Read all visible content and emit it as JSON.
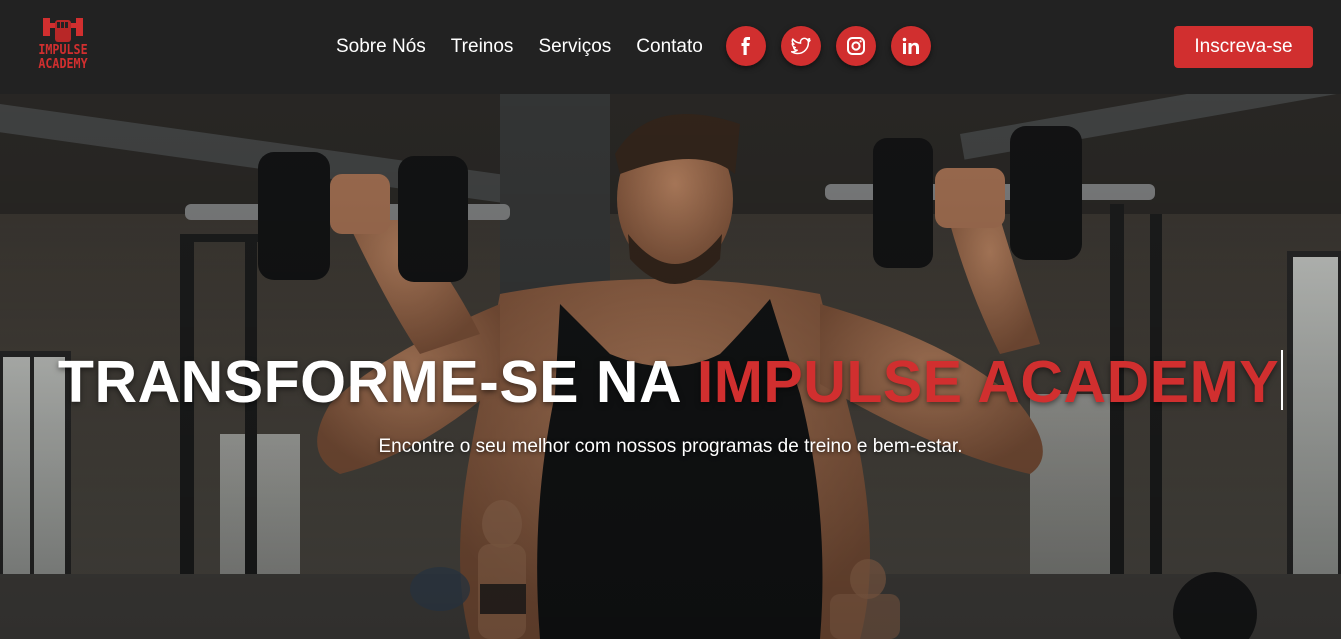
{
  "brand": {
    "logo_line1": "IMPULSE",
    "logo_line2": "ACADEMY",
    "logo_icon": "dumbbell-fist-icon",
    "accent_color": "#d12f2f"
  },
  "nav": {
    "links": [
      "Sobre Nós",
      "Treinos",
      "Serviços",
      "Contato"
    ],
    "socials": [
      "facebook-icon",
      "twitter-icon",
      "instagram-icon",
      "linkedin-icon"
    ],
    "cta_label": "Inscreva-se"
  },
  "hero": {
    "title_main": "TRANSFORME-SE NA ",
    "title_accent": "IMPULSE ACADEMY",
    "subtitle": "Encontre o seu melhor com nossos programas de treino e bem-estar.",
    "background": "man-lifting-dumbbells-gym-photo"
  }
}
